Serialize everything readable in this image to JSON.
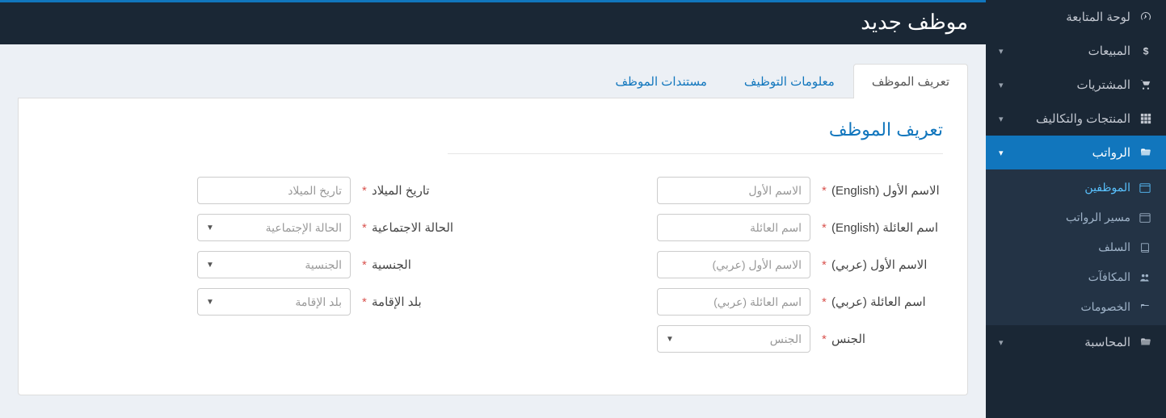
{
  "page": {
    "title": "موظف جديد"
  },
  "sidebar": {
    "items": [
      {
        "id": "dashboard",
        "label": "لوحة المتابعة",
        "icon": "gauge",
        "hasChildren": false
      },
      {
        "id": "sales",
        "label": "المبيعات",
        "icon": "dollar",
        "hasChildren": true
      },
      {
        "id": "purchases",
        "label": "المشتريات",
        "icon": "cart",
        "hasChildren": true
      },
      {
        "id": "products",
        "label": "المنتجات والتكاليف",
        "icon": "grid",
        "hasChildren": true
      },
      {
        "id": "payroll",
        "label": "الرواتب",
        "icon": "folder-open",
        "hasChildren": true,
        "active": true,
        "children": [
          {
            "id": "employees",
            "label": "الموظفين",
            "icon": "calendar",
            "active": true
          },
          {
            "id": "payrun",
            "label": "مسير الرواتب",
            "icon": "calendar"
          },
          {
            "id": "advances",
            "label": "السلف",
            "icon": "book"
          },
          {
            "id": "bonuses",
            "label": "المكافآت",
            "icon": "users"
          },
          {
            "id": "deductions",
            "label": "الخصومات",
            "icon": "folder-open"
          }
        ]
      },
      {
        "id": "accounting",
        "label": "المحاسبة",
        "icon": "folder-open",
        "hasChildren": true
      }
    ]
  },
  "tabs": [
    {
      "id": "def",
      "label": "تعريف الموظف",
      "active": true
    },
    {
      "id": "job",
      "label": "معلومات التوظيف"
    },
    {
      "id": "docs",
      "label": "مستندات الموظف"
    }
  ],
  "section": {
    "title": "تعريف الموظف"
  },
  "form": {
    "first_name_en": {
      "label": "الاسم الأول (English)",
      "required": true,
      "placeholder": "الاسم الأول"
    },
    "last_name_en": {
      "label": "اسم العائلة (English)",
      "required": true,
      "placeholder": "اسم العائلة"
    },
    "first_name_ar": {
      "label": "الاسم الأول (عربي)",
      "required": true,
      "placeholder": "الاسم الأول (عربي)"
    },
    "last_name_ar": {
      "label": "اسم العائلة (عربي)",
      "required": true,
      "placeholder": "اسم العائلة (عربي)"
    },
    "gender": {
      "label": "الجنس",
      "required": true,
      "placeholder": "الجنس"
    },
    "dob": {
      "label": "تاريخ الميلاد",
      "required": true,
      "placeholder": "تاريخ الميلاد"
    },
    "marital": {
      "label": "الحالة الاجتماعية",
      "required": true,
      "placeholder": "الحالة الإجتماعية"
    },
    "nationality": {
      "label": "الجنسية",
      "required": true,
      "placeholder": "الجنسية"
    },
    "residence": {
      "label": "بلد الإقامة",
      "required": true,
      "placeholder": "بلد الإقامة"
    }
  }
}
